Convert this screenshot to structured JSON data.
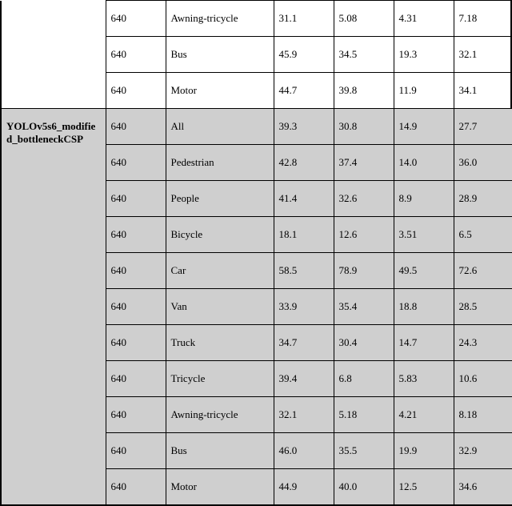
{
  "chart_data": {
    "type": "table",
    "sections": [
      {
        "name": "",
        "shaded": false,
        "rows": [
          {
            "size": "640",
            "class": "Awning-tricycle",
            "c3": "31.1",
            "c4": "5.08",
            "c5": "4.31",
            "c6": "7.18"
          },
          {
            "size": "640",
            "class": "Bus",
            "c3": "45.9",
            "c4": "34.5",
            "c5": "19.3",
            "c6": "32.1"
          },
          {
            "size": "640",
            "class": "Motor",
            "c3": "44.7",
            "c4": "39.8",
            "c5": "11.9",
            "c6": "34.1"
          }
        ]
      },
      {
        "name": "YOLOv5s6_modified_bottleneckCSP",
        "shaded": true,
        "rows": [
          {
            "size": "640",
            "class": "All",
            "c3": "39.3",
            "c4": "30.8",
            "c5": "14.9",
            "c6": "27.7"
          },
          {
            "size": "640",
            "class": "Pedestrian",
            "c3": "42.8",
            "c4": "37.4",
            "c5": "14.0",
            "c6": "36.0"
          },
          {
            "size": "640",
            "class": "People",
            "c3": "41.4",
            "c4": "32.6",
            "c5": "8.9",
            "c6": "28.9"
          },
          {
            "size": "640",
            "class": "Bicycle",
            "c3": "18.1",
            "c4": "12.6",
            "c5": "3.51",
            "c6": "6.5"
          },
          {
            "size": "640",
            "class": "Car",
            "c3": "58.5",
            "c4": "78.9",
            "c5": "49.5",
            "c6": "72.6"
          },
          {
            "size": "640",
            "class": "Van",
            "c3": "33.9",
            "c4": "35.4",
            "c5": "18.8",
            "c6": "28.5"
          },
          {
            "size": "640",
            "class": "Truck",
            "c3": "34.7",
            "c4": "30.4",
            "c5": "14.7",
            "c6": "24.3"
          },
          {
            "size": "640",
            "class": "Tricycle",
            "c3": "39.4",
            "c4": "6.8",
            "c5": "5.83",
            "c6": "10.6"
          },
          {
            "size": "640",
            "class": "Awning-tricycle",
            "c3": "32.1",
            "c4": "5.18",
            "c5": "4.21",
            "c6": "8.18"
          },
          {
            "size": "640",
            "class": "Bus",
            "c3": "46.0",
            "c4": "35.5",
            "c5": "19.9",
            "c6": "32.9"
          },
          {
            "size": "640",
            "class": "Motor",
            "c3": "44.9",
            "c4": "40.0",
            "c5": "12.5",
            "c6": "34.6"
          }
        ]
      }
    ]
  }
}
